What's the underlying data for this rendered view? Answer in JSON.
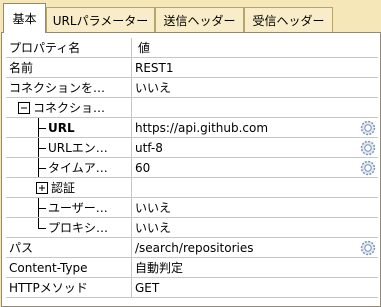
{
  "tabs": [
    {
      "label": "基本"
    },
    {
      "label": "URLパラメーター"
    },
    {
      "label": "送信ヘッダー"
    },
    {
      "label": "受信ヘッダー"
    }
  ],
  "grid": {
    "header_name": "プロパティ名",
    "header_value": "値",
    "rows": [
      {
        "name": "名前",
        "value": "REST1"
      },
      {
        "name": "コネクションを…",
        "value": "いいえ"
      },
      {
        "name": "コネクショ…",
        "value": ""
      },
      {
        "name": "URL",
        "value": "https://api.github.com"
      },
      {
        "name": "URLエン…",
        "value": "utf-8"
      },
      {
        "name": "タイムア…",
        "value": "60"
      },
      {
        "name": "認証",
        "value": ""
      },
      {
        "name": "ユーザー…",
        "value": "いいえ"
      },
      {
        "name": "プロキシ…",
        "value": "いいえ"
      },
      {
        "name": "パス",
        "value": "/search/repositories"
      },
      {
        "name": "Content-Type",
        "value": "自動判定"
      },
      {
        "name": "HTTPメソッド",
        "value": "GET"
      }
    ]
  },
  "icons": {
    "expand": "plus-box-icon",
    "collapse": "minus-box-icon",
    "settings": "gear-icon"
  },
  "colors": {
    "background": "#f5e7b8",
    "grid_line": "#c6c6c6",
    "tab_border": "#8f8a7a"
  }
}
